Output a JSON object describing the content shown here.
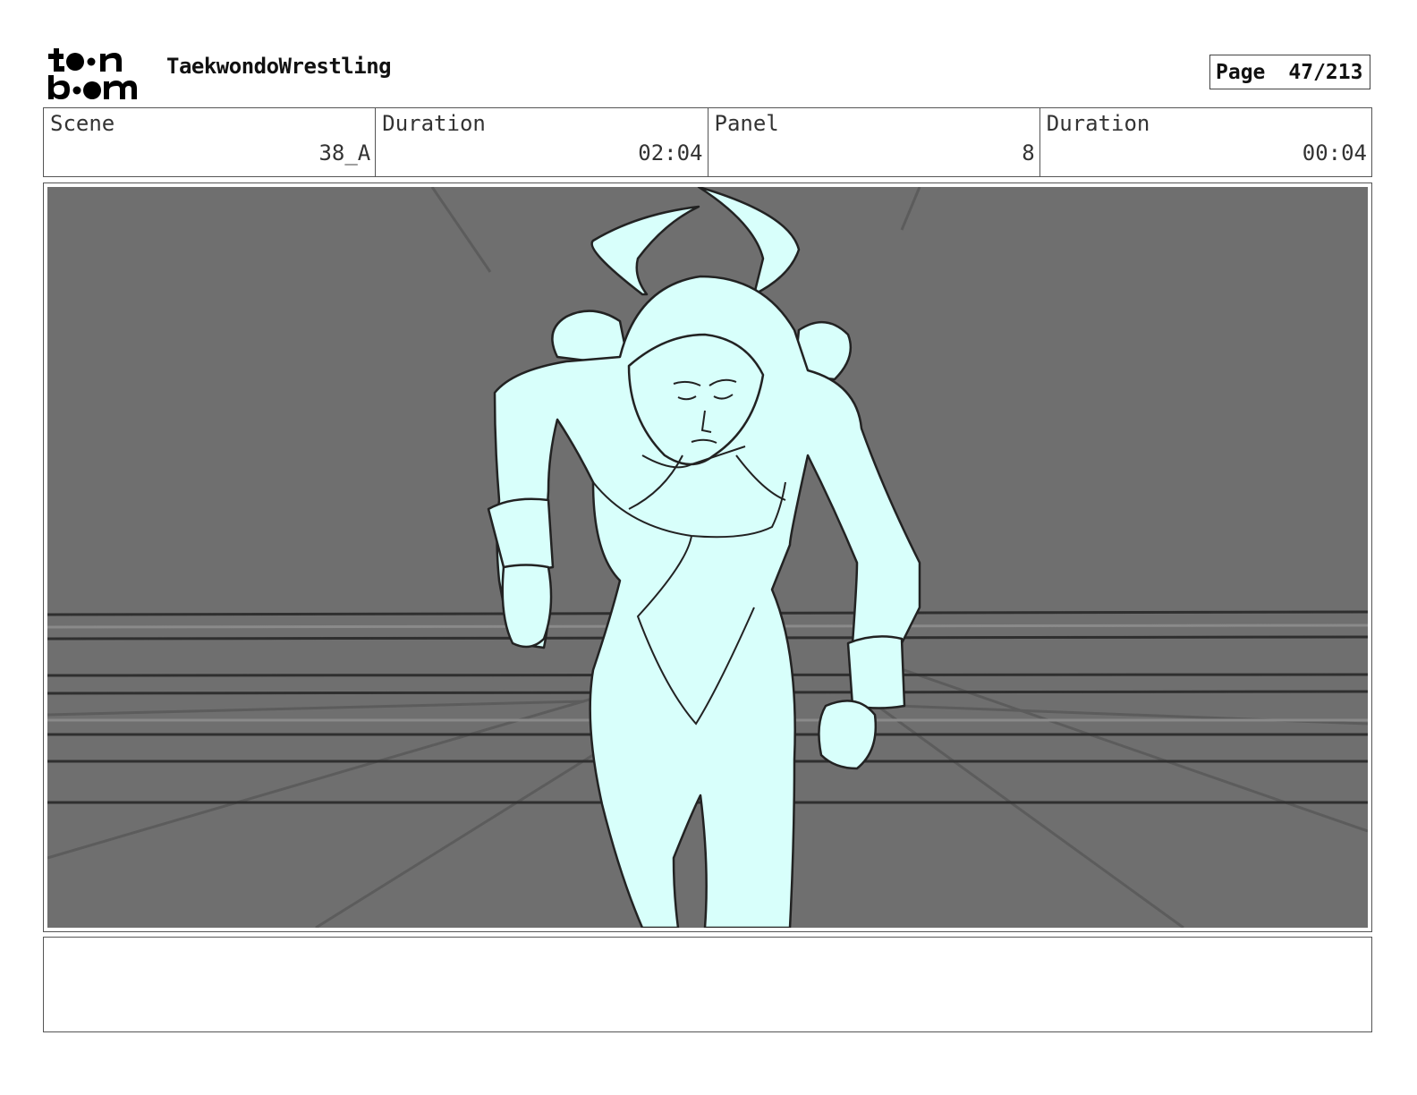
{
  "header": {
    "logo": {
      "line1": "toon",
      "line2": "boom"
    },
    "project_title": "TaekwondoWrestling",
    "page_label": "Page",
    "page_number": "47/213"
  },
  "info": [
    {
      "label": "Scene",
      "value": "38_A"
    },
    {
      "label": "Duration",
      "value": "02:04"
    },
    {
      "label": "Panel",
      "value": "8"
    },
    {
      "label": "Duration",
      "value": "00:04"
    }
  ],
  "panel": {
    "background_color": "#6f6f6f",
    "figure_color": "#d8fffb",
    "line_color": "#222222"
  },
  "notes": {
    "text": ""
  }
}
